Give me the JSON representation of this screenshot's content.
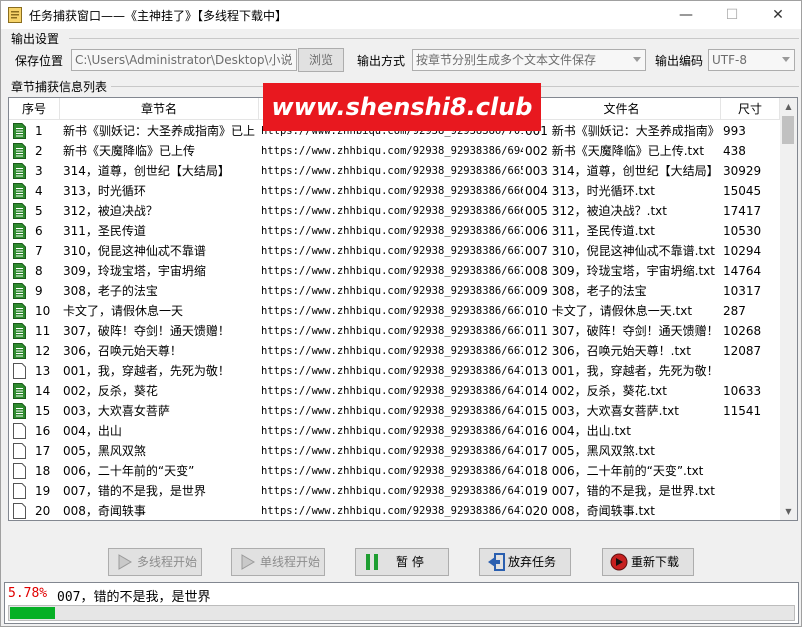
{
  "window": {
    "title": "任务捕获窗口——《主神挂了》【多线程下载中】",
    "minimize": "—",
    "maximize": "☐",
    "close": "✕"
  },
  "output": {
    "group_label": "输出设置",
    "save_location_label": "保存位置",
    "save_location_value": "C:\\Users\\Administrator\\Desktop\\小说",
    "browse_label": "浏览",
    "output_mode_label": "输出方式",
    "output_mode_value": "按章节分别生成多个文本文件保存",
    "encoding_label": "输出编码",
    "encoding_value": "UTF-8"
  },
  "list": {
    "group_label": "章节捕获信息列表",
    "columns": [
      "序号",
      "章节名",
      "",
      "文件名",
      "尺寸"
    ],
    "rows": [
      {
        "no": "1",
        "chapter": "新书《驯妖记：大圣养成指南》已上",
        "url": "https://www.zhhbiqu.com/92938_92938386/7017",
        "file": "001 新书《驯妖记：大圣养成指南》",
        "size": "993",
        "done": true
      },
      {
        "no": "2",
        "chapter": "新书《天魔降临》已上传",
        "url": "https://www.zhhbiqu.com/92938_92938386/69430",
        "file": "002 新书《天魔降临》已上传.txt",
        "size": "438",
        "done": true
      },
      {
        "no": "3",
        "chapter": "314，道尊，创世纪【大结局】",
        "url": "https://www.zhhbiqu.com/92938_92938386/66560",
        "file": "003 314，道尊，创世纪【大结局】",
        "size": "30929",
        "done": true
      },
      {
        "no": "4",
        "chapter": "313，时光循环",
        "url": "https://www.zhhbiqu.com/92938_92938386/66640",
        "file": "004 313，时光循环.txt",
        "size": "15045",
        "done": true
      },
      {
        "no": "5",
        "chapter": "312，被迫决战？",
        "url": "https://www.zhhbiqu.com/92938_92938386/66693",
        "file": "005 312，被迫决战？.txt",
        "size": "17417",
        "done": true
      },
      {
        "no": "6",
        "chapter": "311，圣民传道",
        "url": "https://www.zhhbiqu.com/92938_92938386/66711",
        "file": "006 311，圣民传道.txt",
        "size": "10530",
        "done": true
      },
      {
        "no": "7",
        "chapter": "310，倪昆这神仙忒不靠谱",
        "url": "https://www.zhhbiqu.com/92938_92938386/66729",
        "file": "007 310，倪昆这神仙忒不靠谱.txt",
        "size": "10294",
        "done": true
      },
      {
        "no": "8",
        "chapter": "309，玲珑宝塔，宇宙坍缩",
        "url": "https://www.zhhbiqu.com/92938_92938386/66741",
        "file": "008 309，玲珑宝塔，宇宙坍缩.txt",
        "size": "14764",
        "done": true
      },
      {
        "no": "9",
        "chapter": "308，老子的法宝",
        "url": "https://www.zhhbiqu.com/92938_92938386/66760",
        "file": "009 308，老子的法宝",
        "size": "10317",
        "done": true
      },
      {
        "no": "10",
        "chapter": "卡文了，请假休息一天",
        "url": "https://www.zhhbiqu.com/92938_92938386/66775",
        "file": "010 卡文了，请假休息一天.txt",
        "size": "287",
        "done": true
      },
      {
        "no": "11",
        "chapter": "307，破阵！夺剑！通天馈赠！",
        "url": "https://www.zhhbiqu.com/92938_92938386/66783",
        "file": "011 307，破阵！夺剑！通天馈赠！",
        "size": "10268",
        "done": true
      },
      {
        "no": "12",
        "chapter": "306，召唤元始天尊！",
        "url": "https://www.zhhbiqu.com/92938_92938386/66786",
        "file": "012 306，召唤元始天尊！.txt",
        "size": "12087",
        "done": true
      },
      {
        "no": "13",
        "chapter": "001，我，穿越者，先死为敬！",
        "url": "https://www.zhhbiqu.com/92938_92938386/64790",
        "file": "013 001，我，穿越者，先死为敬！",
        "size": "",
        "done": false
      },
      {
        "no": "14",
        "chapter": "002，反杀，葵花",
        "url": "https://www.zhhbiqu.com/92938_92938386/64790",
        "file": "014 002，反杀，葵花.txt",
        "size": "10633",
        "done": true
      },
      {
        "no": "15",
        "chapter": "003，大欢喜女菩萨",
        "url": "https://www.zhhbiqu.com/92938_92938386/64790",
        "file": "015 003，大欢喜女菩萨.txt",
        "size": "11541",
        "done": true
      },
      {
        "no": "16",
        "chapter": "004，出山",
        "url": "https://www.zhhbiqu.com/92938_92938386/64770",
        "file": "016 004，出山.txt",
        "size": "",
        "done": false
      },
      {
        "no": "17",
        "chapter": "005，黑风双煞",
        "url": "https://www.zhhbiqu.com/92938_92938386/64764",
        "file": "017 005，黑风双煞.txt",
        "size": "",
        "done": false
      },
      {
        "no": "18",
        "chapter": "006，二十年前的“天变”",
        "url": "https://www.zhhbiqu.com/92938_92938386/64753",
        "file": "018 006，二十年前的“天变”.txt",
        "size": "",
        "done": false
      },
      {
        "no": "19",
        "chapter": "007，错的不是我，是世界",
        "url": "https://www.zhhbiqu.com/92938_92938386/64751",
        "file": "019 007，错的不是我，是世界.txt",
        "size": "",
        "done": false
      },
      {
        "no": "20",
        "chapter": "008，奇闻轶事",
        "url": "https://www.zhhbiqu.com/92938_92938386/64737",
        "file": "020 008，奇闻轶事.txt",
        "size": "",
        "done": false
      }
    ]
  },
  "watermark": "www.shenshi8.club",
  "toolbar": {
    "multi_thread": "多线程开始",
    "single_thread": "单线程开始",
    "pause": "暂 停",
    "abandon": "放弃任务",
    "redownload": "重新下载"
  },
  "status": {
    "percent": "5.78%",
    "message": "007，错的不是我，是世界",
    "progress": 0.0578
  },
  "colors": {
    "progress_fill": "#06b025",
    "percent_text": "#e00000",
    "watermark_bg": "#e8181f",
    "done_icon": "#2e8b2e"
  }
}
